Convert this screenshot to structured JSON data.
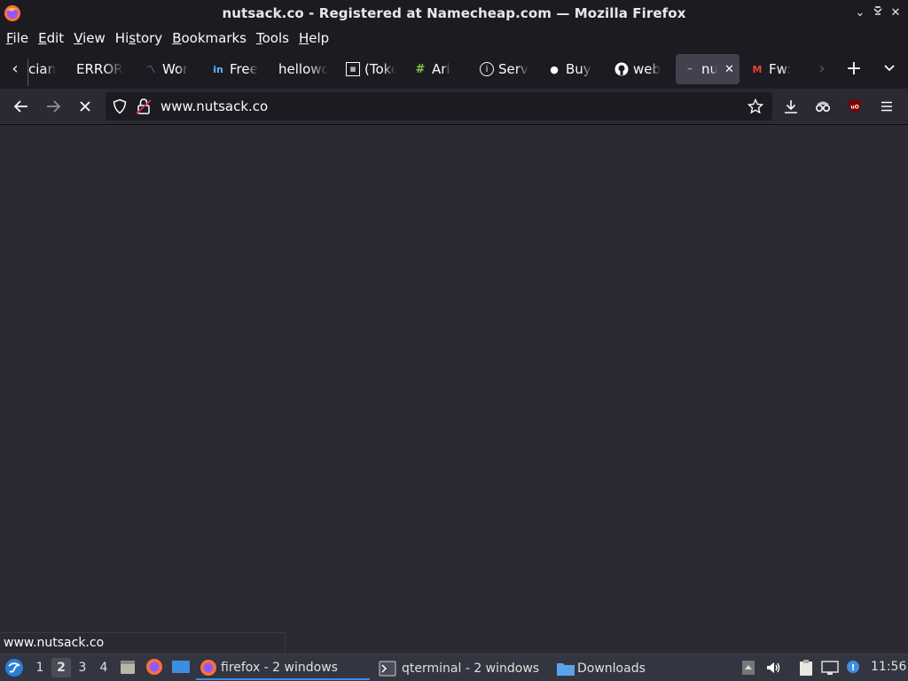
{
  "window": {
    "title": "nutsack.co - Registered at Namecheap.com — Mozilla Firefox",
    "controls": [
      "minimize",
      "maximize",
      "close"
    ]
  },
  "menubar": {
    "items": [
      {
        "label": "File",
        "accel": "F",
        "rest": "ile"
      },
      {
        "label": "Edit",
        "accel": "E",
        "rest": "dit"
      },
      {
        "label": "View",
        "accel": "V",
        "rest": "iew"
      },
      {
        "label": "History",
        "accel": "",
        "rest": "History"
      },
      {
        "label": "Bookmarks",
        "accel": "B",
        "rest": "ookmarks"
      },
      {
        "label": "Tools",
        "accel": "T",
        "rest": "ools"
      },
      {
        "label": "Help",
        "accel": "H",
        "rest": "elp"
      }
    ]
  },
  "tabs": [
    {
      "label": "cian",
      "icon": "none"
    },
    {
      "label": "ERROR",
      "icon": "none"
    },
    {
      "label": "Wor",
      "icon": "wave-icon"
    },
    {
      "label": "Free",
      "icon": "linkedin-icon"
    },
    {
      "label": "hellowo",
      "icon": "none"
    },
    {
      "label": "(Toke",
      "icon": "grid-icon"
    },
    {
      "label": "Ari",
      "icon": "hash-icon"
    },
    {
      "label": "Serv",
      "icon": "info-icon"
    },
    {
      "label": "Buy",
      "icon": "drop-icon"
    },
    {
      "label": "web",
      "icon": "github-icon"
    },
    {
      "label": "nu",
      "icon": "loading-icon",
      "active": true
    },
    {
      "label": "Fw:",
      "icon": "gmail-icon"
    }
  ],
  "navbar": {
    "url": "www.nutsack.co"
  },
  "status": {
    "text": "www.nutsack.co"
  },
  "taskbar": {
    "workspaces": [
      "1",
      "2",
      "3",
      "4"
    ],
    "current_workspace": "2",
    "tasks": [
      {
        "label": "firefox - 2 windows",
        "icon": "firefox-icon"
      },
      {
        "label": "qterminal - 2 windows",
        "icon": "terminal-icon"
      },
      {
        "label": "Downloads",
        "icon": "folder-icon"
      }
    ],
    "clock": "11:56"
  },
  "colors": {
    "chrome": "#1c1b22",
    "toolbar": "#2b2a33",
    "active_tab": "#42414d",
    "taskbar": "#333540",
    "accent": "#3d8ee0"
  }
}
